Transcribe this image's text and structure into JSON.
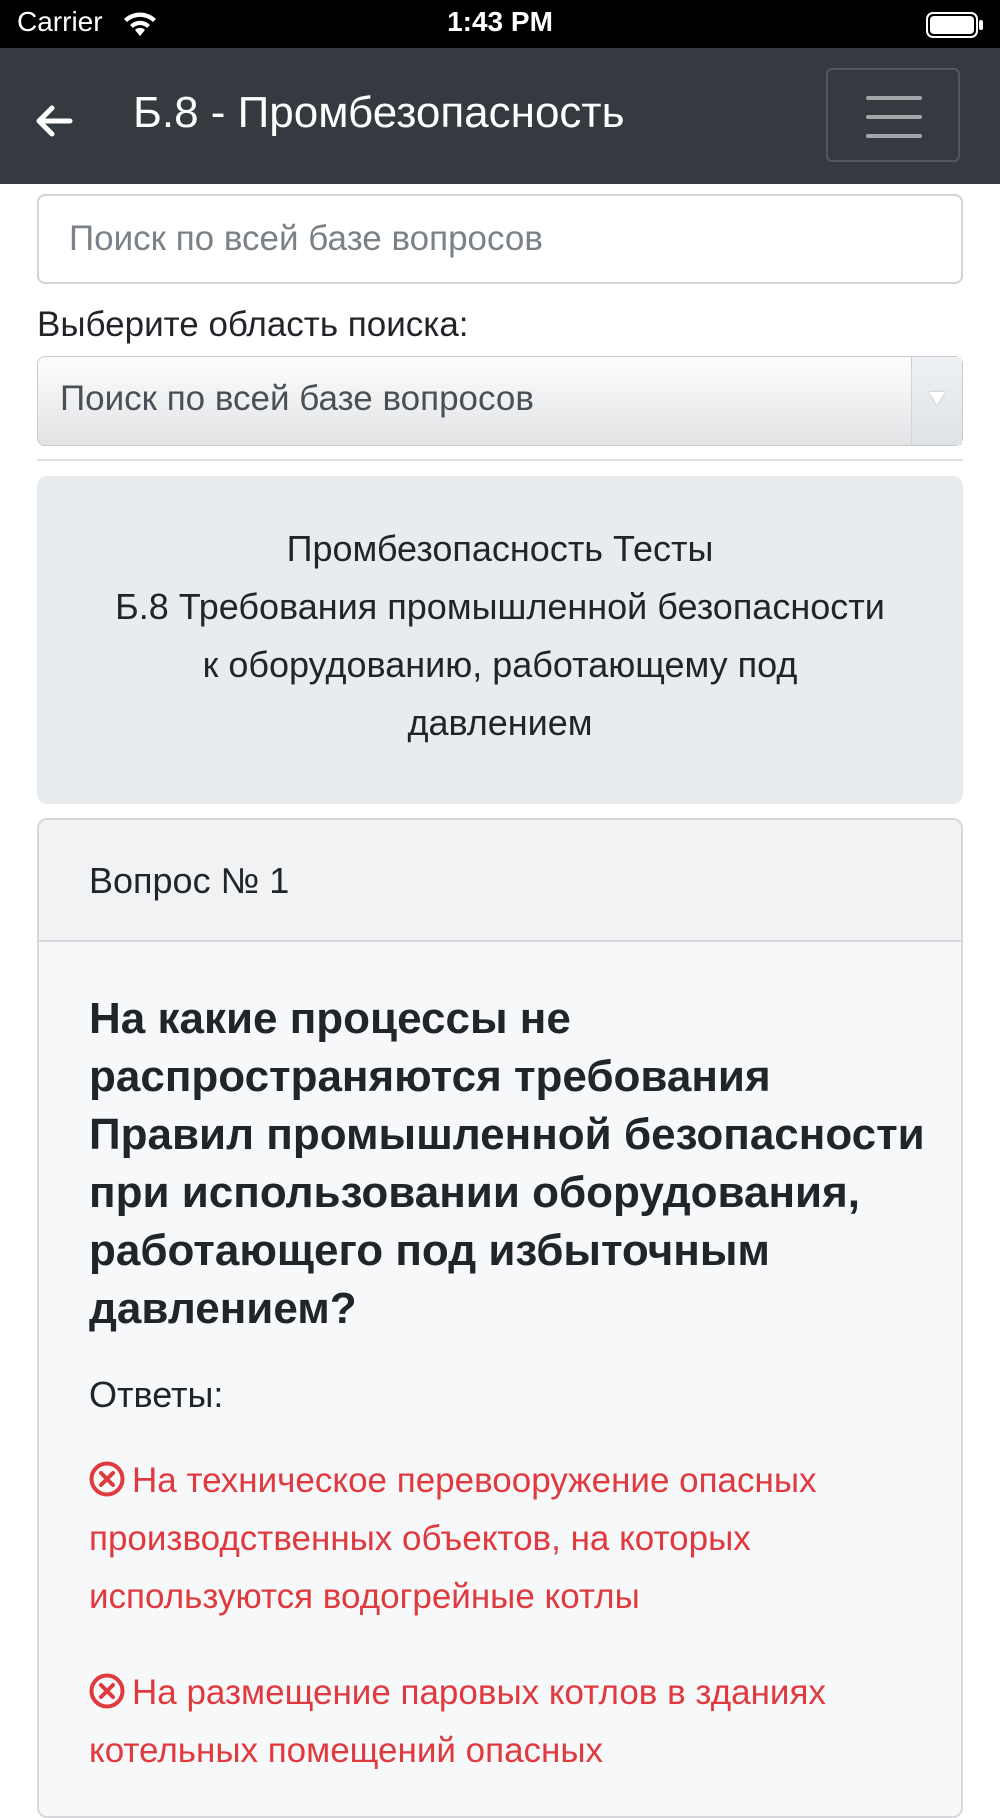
{
  "status_bar": {
    "carrier": "Carrier",
    "time": "1:43 PM"
  },
  "navbar": {
    "title": "Б.8 - Промбезопасность"
  },
  "search": {
    "placeholder": "Поиск по всей базе вопросов"
  },
  "scope": {
    "label": "Выберите область поиска:",
    "selected": "Поиск по всей базе вопросов"
  },
  "header_card": {
    "lines": [
      "Промбезопасность Тесты",
      "Б.8 Требования промышленной безопасности",
      "к оборудованию, работающему под",
      "давлением"
    ]
  },
  "question": {
    "number": "Вопрос № 1",
    "text": "На какие процессы не распространяются требования Правил промышленной безопасности при использовании оборудования, работающего под избыточным давлением?",
    "answers_label": "Ответы:",
    "answers": [
      {
        "status": "incorrect",
        "lines": [
          "На техническое перевооружение опасных",
          "производственных объектов, на которых",
          "используются водогрейные котлы"
        ]
      },
      {
        "status": "incorrect",
        "lines": [
          "На размещение паровых котлов в зданиях",
          "котельных помещений опасных"
        ]
      }
    ]
  },
  "colors": {
    "navbar_bg": "#343a40",
    "header_card_bg": "#e9ecef",
    "answer_incorrect": "#e0393e"
  },
  "icons": {
    "status": [
      "wifi-icon",
      "battery-icon"
    ],
    "nav": [
      "back-arrow-icon",
      "hamburger-menu-icon"
    ],
    "answer_status": "x-circle-icon"
  }
}
